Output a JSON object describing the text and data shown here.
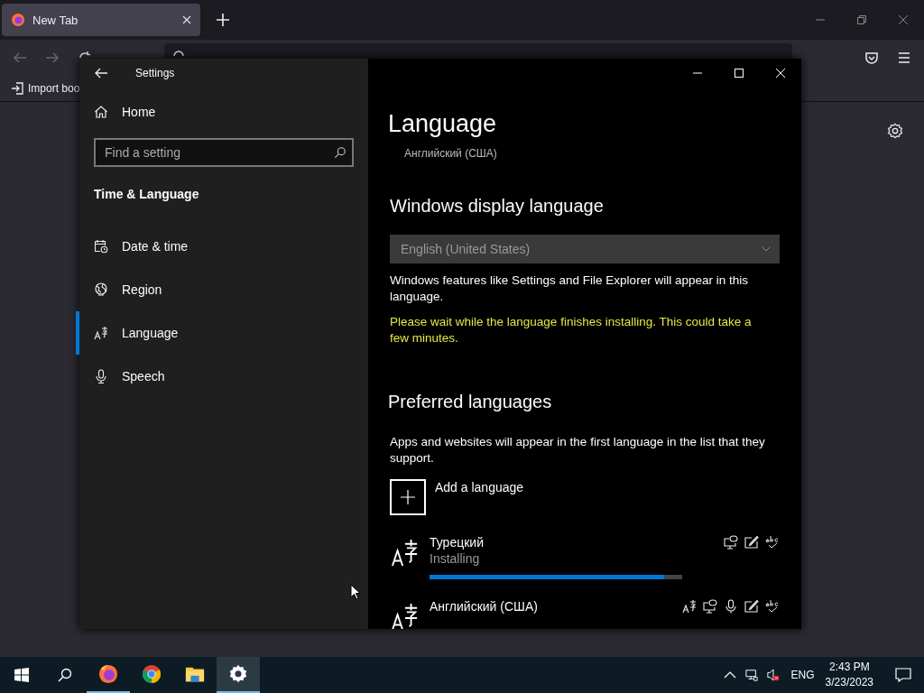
{
  "browser": {
    "tab": {
      "title": "New Tab",
      "selected": true
    },
    "bookmarks": [
      {
        "label": "Import boo"
      }
    ]
  },
  "settings": {
    "title": "Settings",
    "home": "Home",
    "search": {
      "placeholder": "Find a setting"
    },
    "section": "Time & Language",
    "nav": [
      {
        "label": "Date & time",
        "kind": "calendar",
        "selected": false
      },
      {
        "label": "Region",
        "kind": "globe",
        "selected": false
      },
      {
        "label": "Language",
        "kind": "language",
        "selected": true
      },
      {
        "label": "Speech",
        "kind": "microphone",
        "selected": false
      }
    ],
    "page": {
      "title": "Language",
      "cut_item": "Английский (США)",
      "display_heading": "Windows display language",
      "display_dropdown": {
        "value": "English (United States)"
      },
      "display_note": "Windows features like Settings and File Explorer will appear in this language.",
      "warning": "Please wait while the language finishes installing. This could take a few minutes.",
      "preferred_heading": "Preferred languages",
      "preferred_note": "Apps and websites will appear in the first language in the list that they support.",
      "add_label": "Add a language",
      "languages": [
        {
          "name": "Турецкий",
          "status": "Installing",
          "level": 0.93,
          "features": [
            {
              "kind": "display"
            },
            {
              "kind": "handwriting"
            },
            {
              "kind": "spelling"
            }
          ]
        },
        {
          "name": "Английский (США)",
          "features": [
            {
              "kind": "language"
            },
            {
              "kind": "display"
            },
            {
              "kind": "speech"
            },
            {
              "kind": "handwriting"
            },
            {
              "kind": "spelling"
            }
          ]
        }
      ]
    }
  },
  "taskbar": {
    "apps": [
      {
        "kind": "firefox",
        "running": true,
        "selected": false
      },
      {
        "kind": "chrome",
        "running": false,
        "selected": false
      },
      {
        "kind": "explorer",
        "running": false,
        "selected": false
      },
      {
        "kind": "settings",
        "running": true,
        "selected": true
      }
    ],
    "language": "ENG",
    "time": "2:43 PM",
    "date": "3/23/2023"
  }
}
